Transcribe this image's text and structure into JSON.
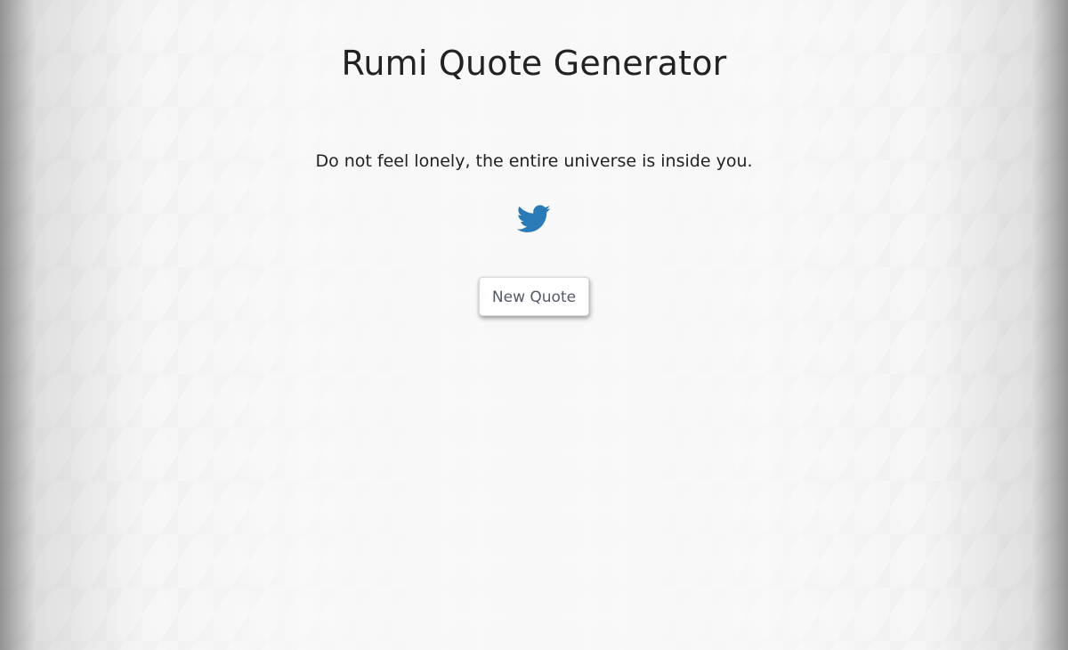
{
  "page": {
    "title": "Rumi Quote Generator"
  },
  "quote": {
    "text": "Do not feel lonely, the entire universe is inside you."
  },
  "share": {
    "icon": "twitter-bird-icon",
    "color": "#2a7ab8"
  },
  "actions": {
    "new_quote_label": "New Quote"
  },
  "theme": {
    "background": "#f8f8f8",
    "text": "#222222",
    "button_text": "#555b66"
  }
}
